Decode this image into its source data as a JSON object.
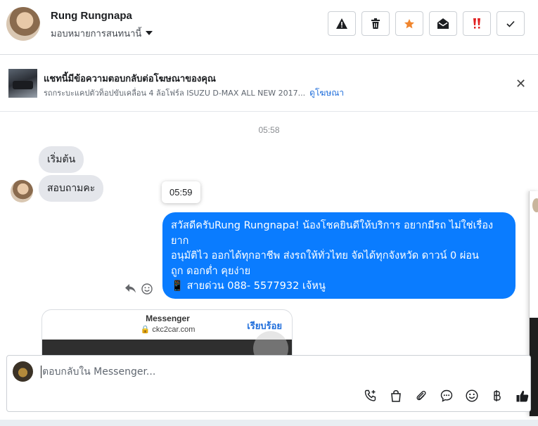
{
  "header": {
    "name": "Rung Rungnapa",
    "assign_label": "มอบหมายการสนทนานี้"
  },
  "ad": {
    "title": "แชทนี้มีข้อความตอบกลับต่อโฆษณาของคุณ",
    "subtitle": "รถกระบะแคปตัวท็อปขับเคลื่อน 4 ล้อโฟร์ล ISUZU D-MAX ALL NEW 2017...",
    "link": "ดูโฆษณา",
    "close": "✕"
  },
  "chat": {
    "timestamp": "05:58",
    "incoming": [
      "เริ่มต้น",
      "สอบถามคะ"
    ],
    "tooltip_time": "05:59",
    "outgoing_lines": [
      "สวัสดีครับRung Rungnapa! น้องโชคยินดีให้บริการ อยากมีรถ ไม่ใช่เรื่อง",
      "ยาก",
      "อนุมัติไว ออกได้ทุกอาชีพ ส่งรถให้ทั่วไทย จัดได้ทุกจังหวัด ดาวน์ 0  ผ่อน",
      "ถูก ดอกต่ำ คุยง่าย",
      "📱 สายด่วน 088- 5577932 เจ้หนู"
    ],
    "card": {
      "title": "Messenger",
      "url": "ckc2car.com",
      "done": "เรียบร้อย"
    }
  },
  "composer": {
    "placeholder": "ตอบกลับใน Messenger..."
  },
  "colors": {
    "outgoing_bubble": "#0a7cff",
    "incoming_bubble": "#e4e6eb",
    "link": "#216fdb",
    "star": "#f0852d",
    "important": "#e02020"
  }
}
